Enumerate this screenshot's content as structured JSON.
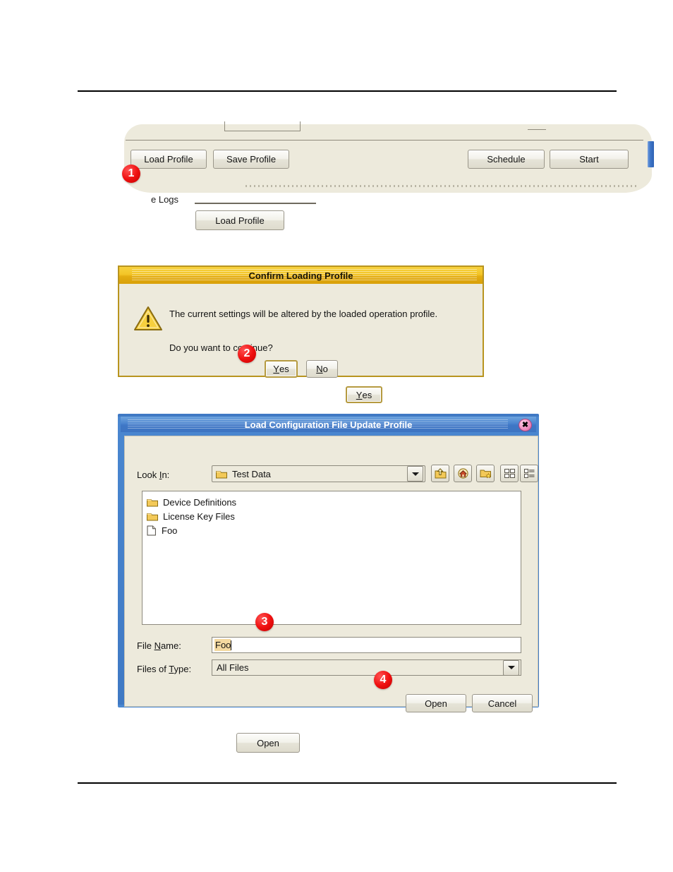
{
  "document": {
    "rule_top": "",
    "rule_bottom": ""
  },
  "top_panel": {
    "group_label": "e Logs",
    "buttons": {
      "load_profile": "Load Profile",
      "save_profile": "Save Profile",
      "schedule": "Schedule",
      "start": "Start"
    }
  },
  "callouts": {
    "one": "1",
    "two": "2",
    "three": "3",
    "four": "4"
  },
  "standalone": {
    "load_profile": "Load Profile",
    "yes": "Yes",
    "open": "Open"
  },
  "confirm_dialog": {
    "title": "Confirm Loading Profile",
    "icon": "warning-triangle-icon",
    "message_line_1": "The current settings will be altered by the loaded operation profile.",
    "message_line_2": "Do you want to continue?",
    "yes_prefix": "Y",
    "yes_rest": "es",
    "no_prefix": "N",
    "no_rest": "o"
  },
  "file_dialog": {
    "title": "Load Configuration File Update Profile",
    "close_glyph": "✖",
    "look_in": {
      "label_pre": "Look ",
      "label_mn": "I",
      "label_post": "n:",
      "value": "Test Data",
      "icon": "folder-icon"
    },
    "toolbar": [
      {
        "name": "up-one-level-icon",
        "tip": "Up One Level"
      },
      {
        "name": "home-icon",
        "tip": "Home"
      },
      {
        "name": "create-new-folder-icon",
        "tip": "Create New Folder"
      },
      {
        "name": "list-view-icon",
        "tip": "List"
      },
      {
        "name": "details-view-icon",
        "tip": "Details"
      }
    ],
    "files": [
      {
        "name": "Device Definitions",
        "type": "folder"
      },
      {
        "name": "License Key Files",
        "type": "folder"
      },
      {
        "name": "Foo",
        "type": "file"
      }
    ],
    "file_name": {
      "label_pre": "File ",
      "label_mn": "N",
      "label_post": "ame:",
      "value": "Foo"
    },
    "files_of_type": {
      "label_pre": "Files of ",
      "label_mn": "T",
      "label_post": "ype:",
      "value": "All Files"
    },
    "open_button": "Open",
    "cancel_button": "Cancel"
  },
  "colors": {
    "badge_red": "#ef1010",
    "confirm_title_gold": "#f3c528",
    "dialog_frame_blue": "#3f79c4",
    "panel_beige": "#edeadc",
    "selection_tan": "#f4d9a0",
    "scroll_thumb_blue": "#3f76c8",
    "close_button_pink": "#f39ac8"
  }
}
